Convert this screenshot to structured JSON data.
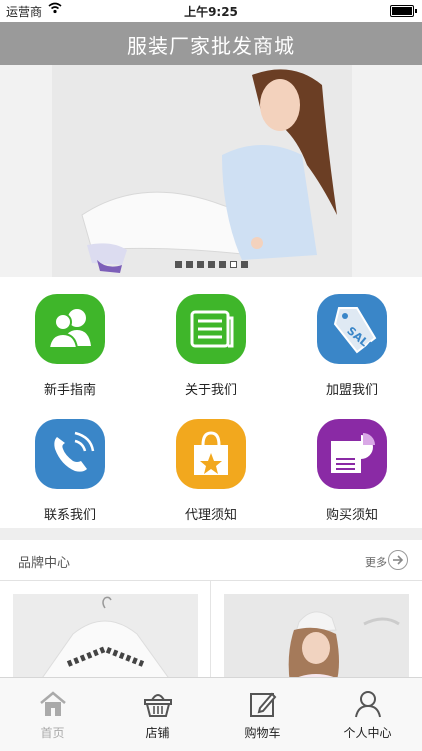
{
  "status": {
    "carrier": "运营商",
    "time": "上午9:25"
  },
  "navbar": {
    "title": "服装厂家批发商城"
  },
  "grid": {
    "items": [
      {
        "label": "新手指南",
        "icon": "users-icon",
        "color": "#3fb62a"
      },
      {
        "label": "关于我们",
        "icon": "document-icon",
        "color": "#3fb62a"
      },
      {
        "label": "加盟我们",
        "icon": "sale-tag-icon",
        "color": "#3a86c8"
      },
      {
        "label": "联系我们",
        "icon": "phone-icon",
        "color": "#3a86c8"
      },
      {
        "label": "代理须知",
        "icon": "shopping-bag-icon",
        "color": "#f2a81e"
      },
      {
        "label": "购买须知",
        "icon": "chart-report-icon",
        "color": "#8a2aa5"
      }
    ]
  },
  "brand": {
    "title": "品牌中心",
    "more": "更多"
  },
  "tabbar": {
    "tabs": [
      {
        "label": "首页",
        "icon": "home-icon",
        "active": true
      },
      {
        "label": "店铺",
        "icon": "basket-icon"
      },
      {
        "label": "购物车",
        "icon": "edit-icon"
      },
      {
        "label": "个人中心",
        "icon": "person-icon"
      }
    ]
  }
}
